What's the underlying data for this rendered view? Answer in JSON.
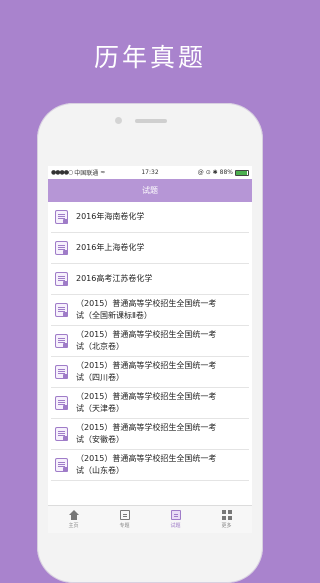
{
  "headline": "历年真题",
  "status_bar": {
    "signal": "●●●●○",
    "carrier": "中国联通",
    "wifi": "≈",
    "time": "17:32",
    "indicators": "@ ⊙ ✱",
    "battery_text": "88%",
    "battery_level": 0.88
  },
  "nav": {
    "title": "试题"
  },
  "items": [
    {
      "text": "2016年海南卷化学"
    },
    {
      "text": "2016年上海卷化学"
    },
    {
      "text": "2016高考江苏卷化学"
    },
    {
      "line1": "（2015）普通高等学校招生全国统一考",
      "line2": "试（全国新课标Ⅱ卷）"
    },
    {
      "line1": "（2015）普通高等学校招生全国统一考",
      "line2": "试（北京卷）"
    },
    {
      "line1": "（2015）普通高等学校招生全国统一考",
      "line2": "试（四川卷）"
    },
    {
      "line1": "（2015）普通高等学校招生全国统一考",
      "line2": "试（天津卷）"
    },
    {
      "line1": "（2015）普通高等学校招生全国统一考",
      "line2": "试（安徽卷）"
    },
    {
      "line1": "（2015）普通高等学校招生全国统一考",
      "line2": "试（山东卷）"
    }
  ],
  "tabs": [
    {
      "label": "主页",
      "icon": "home-icon"
    },
    {
      "label": "专题",
      "icon": "topic-icon"
    },
    {
      "label": "试题",
      "icon": "exam-icon"
    },
    {
      "label": "更多",
      "icon": "more-icon"
    }
  ],
  "colors": {
    "background": "#a983cd",
    "accent": "#b696d6",
    "icon": "#9f7cc8"
  }
}
